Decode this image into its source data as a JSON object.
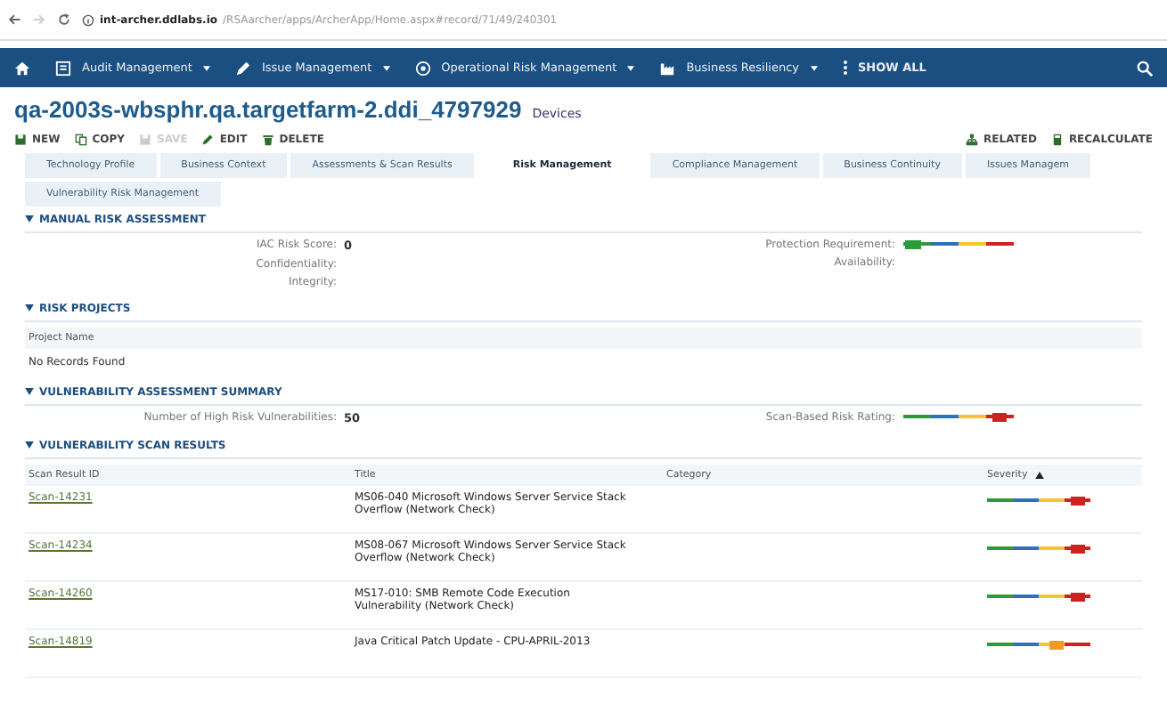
{
  "browser": {
    "url_host": "int-archer.ddlabs.io",
    "url_path": "/RSAarcher/apps/ArcherApp/Home.aspx#record/71/49/240301"
  },
  "nav": {
    "items": [
      {
        "label": "Audit Management"
      },
      {
        "label": "Issue Management"
      },
      {
        "label": "Operational Risk Management"
      },
      {
        "label": "Business Resiliency"
      }
    ],
    "show_all": "SHOW ALL"
  },
  "record": {
    "title": "qa-2003s-wbsphr.qa.targetfarm-2.ddi_4797929",
    "subtitle": "Devices"
  },
  "toolbar": {
    "left": [
      {
        "label": "NEW",
        "disabled": false
      },
      {
        "label": "COPY",
        "disabled": false
      },
      {
        "label": "SAVE",
        "disabled": true
      },
      {
        "label": "EDIT",
        "disabled": false
      },
      {
        "label": "DELETE",
        "disabled": false
      }
    ],
    "right": [
      {
        "label": "RELATED",
        "disabled": false
      },
      {
        "label": "RECALCULATE",
        "disabled": false
      }
    ]
  },
  "tabs": [
    {
      "label": "Technology Profile",
      "selected": false
    },
    {
      "label": "Business Context",
      "selected": false
    },
    {
      "label": "Assessments & Scan Results",
      "selected": false
    },
    {
      "label": "Risk Management",
      "selected": true
    },
    {
      "label": "Compliance Management",
      "selected": false
    },
    {
      "label": "Business Continuity",
      "selected": false
    },
    {
      "label": "Issues Managem",
      "selected": false
    },
    {
      "label": "Vulnerability Risk Management",
      "selected": false
    }
  ],
  "manual_risk_assessment": {
    "heading": "MANUAL RISK ASSESSMENT",
    "left": [
      {
        "label": "IAC Risk Score:",
        "value": "0"
      },
      {
        "label": "Confidentiality:"
      },
      {
        "label": "Integrity:"
      }
    ],
    "right": [
      {
        "label": "Protection Requirement:",
        "level": 0.1
      },
      {
        "label": "Availability:"
      }
    ]
  },
  "risk_projects": {
    "heading": "RISK PROJECTS",
    "column": "Project Name",
    "empty": "No Records Found"
  },
  "vulnerability_summary": {
    "heading": "VULNERABILITY ASSESSMENT SUMMARY",
    "left": {
      "label": "Number of High Risk Vulnerabilities:",
      "value": "50"
    },
    "right": {
      "label": "Scan-Based Risk Rating:",
      "level": 0.88
    }
  },
  "scan_results": {
    "heading": "VULNERABILITY SCAN RESULTS",
    "columns": [
      "Scan Result ID",
      "Title",
      "Category",
      "Severity"
    ],
    "rows": [
      {
        "id": "Scan-14231",
        "title": "MS06-040 Microsoft Windows Server Service Stack Overflow (Network Check)",
        "level": 0.88
      },
      {
        "id": "Scan-14234",
        "title": "MS08-067 Microsoft Windows Server Service Stack Overflow (Network Check)",
        "level": 0.88
      },
      {
        "id": "Scan-14260",
        "title": "MS17-010: SMB Remote Code Execution Vulnerability (Network Check)",
        "level": 0.88
      },
      {
        "id": "Scan-14819",
        "title": "Java Critical Patch Update - CPU-APRIL-2013",
        "level": 0.68
      }
    ]
  }
}
